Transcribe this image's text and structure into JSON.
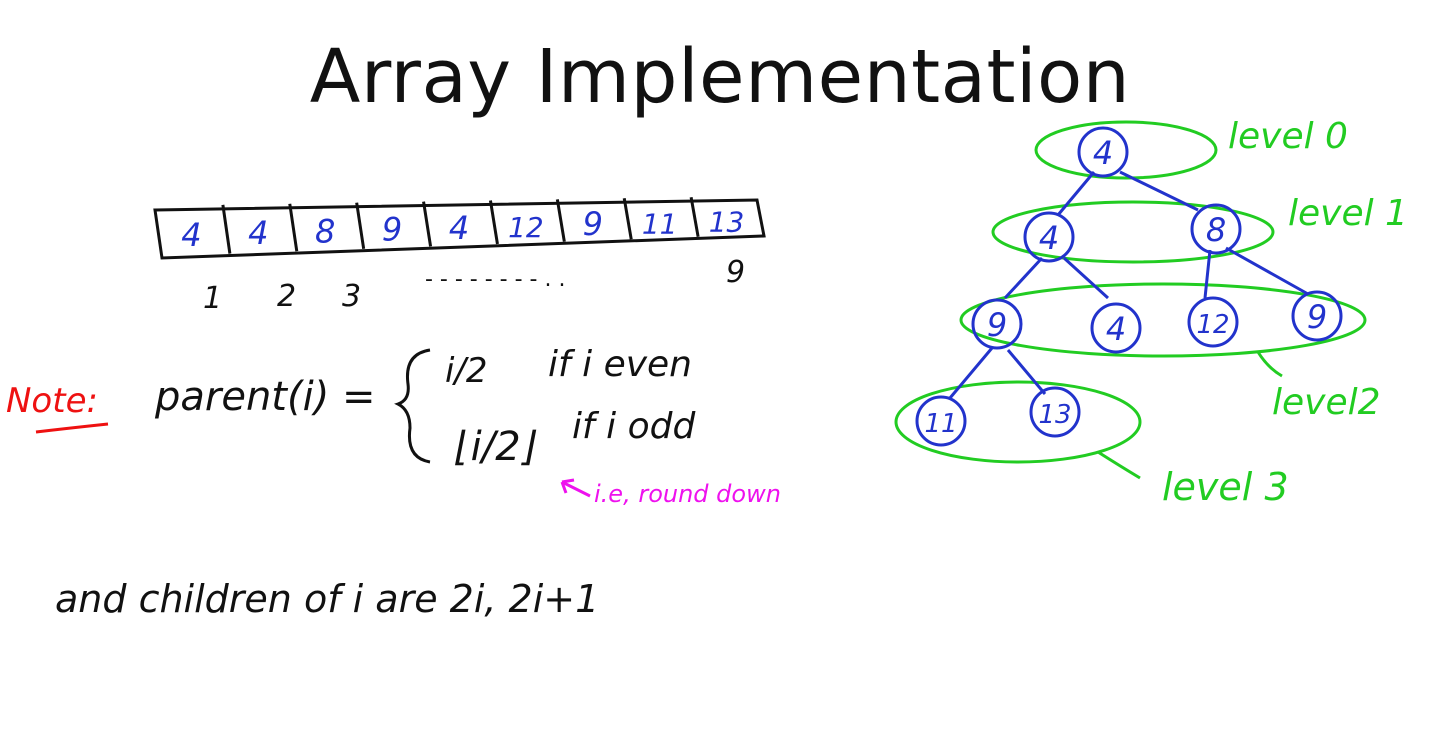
{
  "slide": {
    "title": "Array Implementation"
  },
  "colors": {
    "ink": "#111111",
    "blue": "#2233cc",
    "green": "#22cc22",
    "red": "#ee1111",
    "magenta": "#ee11ee"
  },
  "array": {
    "values": [
      "4",
      "4",
      "8",
      "9",
      "4",
      "12",
      "9",
      "11",
      "13"
    ],
    "index_labels": [
      "1",
      "2",
      "3"
    ],
    "index_ellipsis": "- - - - - - - - . .",
    "last_index": "9"
  },
  "formula": {
    "note_label": "Note:",
    "lhs": "parent(i) =",
    "case_even_expr": "i/2",
    "case_even_cond": "if i even",
    "case_odd_expr": "⌊i/2⌋",
    "case_odd_cond": "if i odd",
    "annotation": "i.e, round down",
    "children": "and children of i are 2i, 2i+1"
  },
  "tree": {
    "nodes": [
      "4",
      "4",
      "8",
      "9",
      "4",
      "12",
      "9",
      "11",
      "13"
    ],
    "levels": [
      "level 0",
      "level 1",
      "level2",
      "level 3"
    ]
  }
}
